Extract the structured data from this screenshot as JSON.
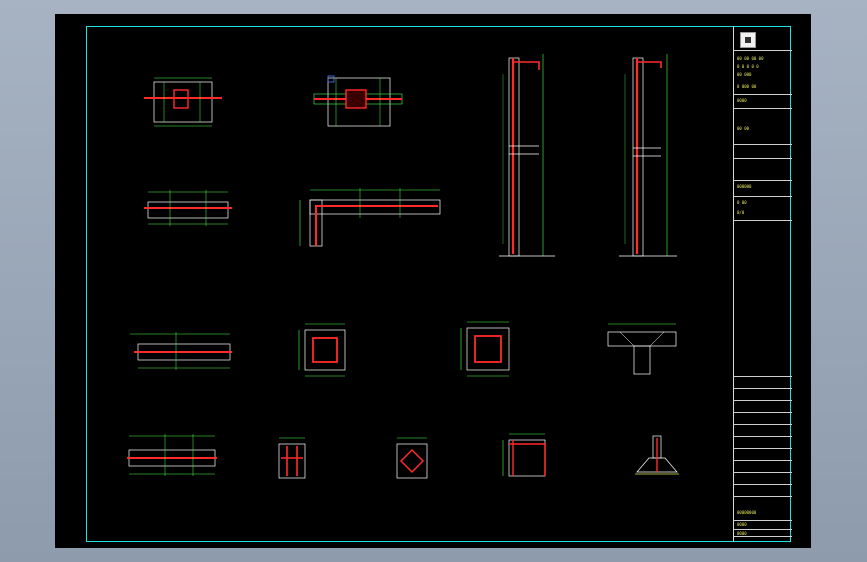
{
  "window": {
    "background": "#000000",
    "frame_color": "#1fe3e3"
  },
  "colors": {
    "rebar": "#ff2a2a",
    "dimension": "#4dff4d",
    "outline": "#ffffff",
    "label": "#e8e85a",
    "caption": "#ff4cff",
    "frame": "#1fe3e3"
  },
  "title_block": {
    "logo_icon": "company-logo-icon",
    "rows": [
      "00 00 00 00",
      "0 0 0 0 0",
      "00 000",
      "0 000 00",
      "0000",
      "00 00",
      "000000",
      "0 00",
      "0/0",
      "00000000",
      "0000",
      "0000",
      "0000",
      "00-0"
    ]
  },
  "captions": [
    "",
    "",
    "",
    "",
    "",
    "",
    "",
    "",
    "",
    "",
    "",
    "",
    "",
    "",
    "",
    ""
  ]
}
